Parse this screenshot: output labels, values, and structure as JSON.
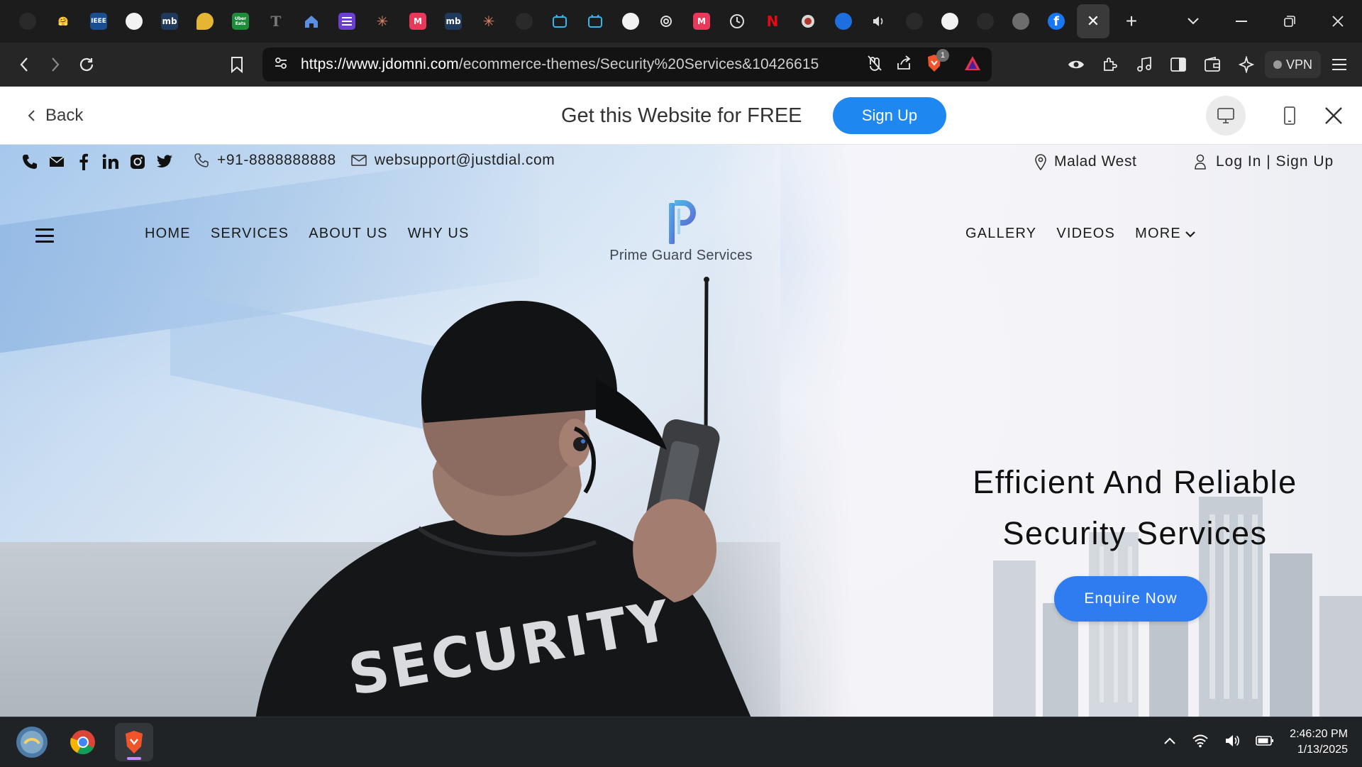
{
  "browser": {
    "tab_close_glyph": "✕",
    "new_tab_glyph": "+",
    "pinned_tabs": [
      {
        "icon": "github-dark-icon",
        "label": "",
        "color": "#1c1c1c"
      },
      {
        "icon": "huggingface-icon",
        "label": "🤗",
        "color": "#1c1c1c"
      },
      {
        "icon": "ieee-icon",
        "label": "IEEE",
        "color": "#1a4f8f"
      },
      {
        "icon": "github-icon",
        "label": "",
        "color": "#1c1c1c"
      },
      {
        "icon": "mb-icon",
        "label": "mb",
        "color": "#203a5c"
      },
      {
        "icon": "maps-pin-icon",
        "label": "",
        "color": "#e5b533"
      },
      {
        "icon": "ubereats-icon",
        "label": "Uber Eats",
        "color": "#1d8c3a"
      },
      {
        "icon": "typography-icon",
        "label": "T",
        "color": "#1c1c1c"
      },
      {
        "icon": "home-icon",
        "label": "",
        "color": "#1c1c1c"
      },
      {
        "icon": "list-icon",
        "label": "",
        "color": "#6a3fd1"
      },
      {
        "icon": "claude-spark-icon",
        "label": "✳",
        "color": "#1c1c1c"
      },
      {
        "icon": "m-red-icon",
        "label": "M",
        "color": "#e8395a"
      },
      {
        "icon": "mb-icon",
        "label": "mb",
        "color": "#203a5c"
      },
      {
        "icon": "claude-spark-icon",
        "label": "✳",
        "color": "#1c1c1c"
      },
      {
        "icon": "github-dark-icon",
        "label": "",
        "color": "#1c1c1c"
      },
      {
        "icon": "bilibili-icon",
        "label": "",
        "color": "#1c1c1c"
      },
      {
        "icon": "bilibili-icon",
        "label": "",
        "color": "#1c1c1c"
      },
      {
        "icon": "github-icon",
        "label": "",
        "color": "#1c1c1c"
      },
      {
        "icon": "openai-icon",
        "label": "",
        "color": "#1c1c1c"
      },
      {
        "icon": "m-red-icon",
        "label": "M",
        "color": "#e8395a"
      },
      {
        "icon": "history-icon",
        "label": "",
        "color": "#1c1c1c"
      },
      {
        "icon": "netflix-icon",
        "label": "N",
        "color": "#1c1c1c"
      },
      {
        "icon": "brave-shield-icon",
        "label": "",
        "color": "#1c1c1c"
      },
      {
        "icon": "play-icon",
        "label": "",
        "color": "#1c1c1c"
      },
      {
        "icon": "speaker-icon",
        "label": "",
        "color": "#1c1c1c"
      },
      {
        "icon": "github-dark-icon",
        "label": "",
        "color": "#1c1c1c"
      },
      {
        "icon": "github-icon",
        "label": "",
        "color": "#1c1c1c"
      },
      {
        "icon": "github-dark-icon",
        "label": "",
        "color": "#1c1c1c"
      },
      {
        "icon": "globe-icon",
        "label": "",
        "color": "#1c1c1c"
      },
      {
        "icon": "facebook-icon",
        "label": "f",
        "color": "#1877f2"
      }
    ],
    "url_host": "https://www.jdomni.com",
    "url_path": "/ecommerce-themes/Security%20Services&10426615",
    "brave_badge": "1",
    "vpn_label": "VPN"
  },
  "banner": {
    "back_label": "Back",
    "promo_text": "Get this Website for FREE",
    "signup_label": "Sign Up"
  },
  "site": {
    "phone": "+91-8888888888",
    "email": "websupport@justdial.com",
    "location": "Malad West",
    "auth_label": "Log In | Sign Up",
    "nav_left": [
      "HOME",
      "SERVICES",
      "ABOUT US",
      "WHY US"
    ],
    "nav_right": [
      "GALLERY",
      "VIDEOS",
      "MORE"
    ],
    "brand_name": "Prime Guard Services",
    "brand_letter": "P",
    "hero_line1": "Efficient And Reliable",
    "hero_line2": "Security Services",
    "cta_label": "Enquire Now",
    "jacket_text": "SECURITY",
    "accent_color": "#2f7cf0"
  },
  "taskbar": {
    "time": "2:46:20 PM",
    "date": "1/13/2025"
  }
}
